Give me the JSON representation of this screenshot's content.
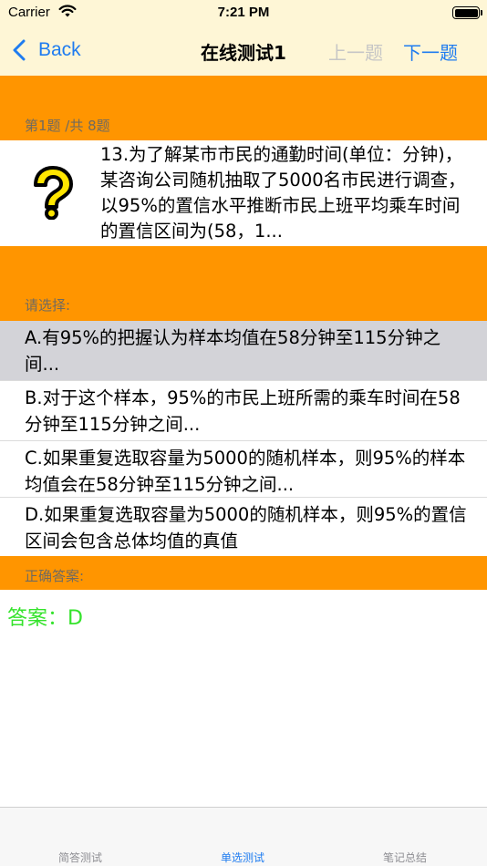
{
  "status_bar": {
    "carrier": "Carrier",
    "time": "7:21 PM"
  },
  "nav": {
    "back_label": "Back",
    "title": "在线测试1",
    "prev_label": "上一题",
    "next_label": "下一题"
  },
  "progress": {
    "label": "第1题 /共 8题"
  },
  "question": {
    "icon": "question-mark-icon",
    "text": "13.为了解某市市民的通勤时间(单位：分钟)，某咨询公司随机抽取了5000名市民进行调查，以95%的置信水平推断市民上班平均乘车时间的置信区间为(58，1..."
  },
  "choose_label": "请选择:",
  "options": [
    {
      "text": "A.有95%的把握认为样本均值在58分钟至115分钟之间..."
    },
    {
      "text": "B.对于这个样本，95%的市民上班所需的乘车时间在58分钟至115分钟之间..."
    },
    {
      "text": "C.如果重复选取容量为5000的随机样本，则95%的样本均值会在58分钟至115分钟之间..."
    },
    {
      "text": "D.如果重复选取容量为5000的随机样本，则95%的置信区间会包含总体均值的真值"
    }
  ],
  "correct_answer_label": "正确答案:",
  "answer": "答案：D",
  "tabs": [
    {
      "label": "简答测试"
    },
    {
      "label": "单选测试"
    },
    {
      "label": "笔记总结"
    }
  ],
  "colors": {
    "accent": "#1f7cf0",
    "band": "#ff9500",
    "bar_bg": "#fef6d6",
    "answer": "#35e32c",
    "selected_option": "#d3d3d8"
  }
}
